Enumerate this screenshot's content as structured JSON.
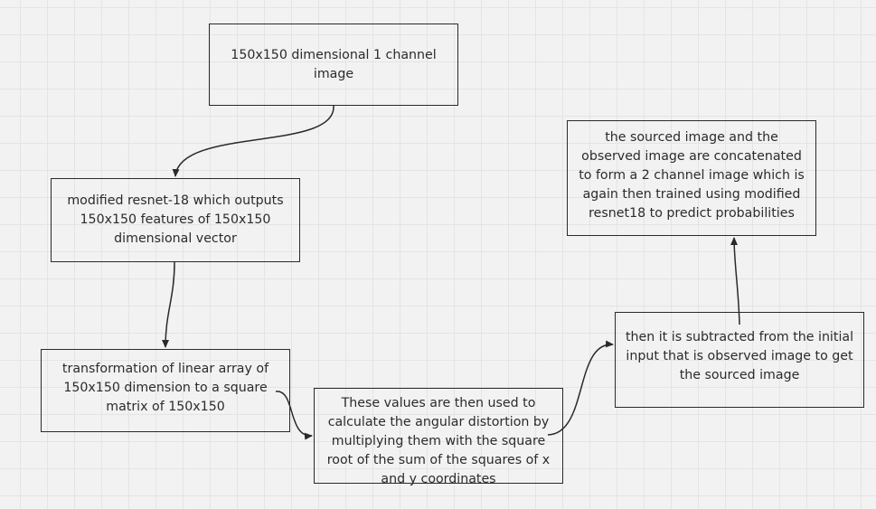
{
  "nodes": {
    "input_image": "150x150 dimensional 1 channel image",
    "resnet_features": "modified resnet-18 which outputs 150x150 features of 150x150 dimensional vector",
    "transformation": "transformation of linear array of 150x150 dimension to a square matrix of 150x150",
    "angular_distortion": "These values are then used to calculate the angular distortion by multiplying them with the square root of the sum of the squares of x and y coordinates",
    "subtraction": "then it is subtracted from the initial input that is observed image to get the sourced image",
    "concatenation": "the sourced image and the observed image are concatenated to form a 2 channel image which is again then trained using modified resnet18 to predict probabilities"
  },
  "edges": [
    {
      "from": "input_image",
      "to": "resnet_features"
    },
    {
      "from": "resnet_features",
      "to": "transformation"
    },
    {
      "from": "transformation",
      "to": "angular_distortion"
    },
    {
      "from": "angular_distortion",
      "to": "subtraction"
    },
    {
      "from": "subtraction",
      "to": "concatenation"
    }
  ],
  "colors": {
    "background": "#f2f2f2",
    "grid": "#e4e4e4",
    "stroke": "#2a2a2a"
  }
}
